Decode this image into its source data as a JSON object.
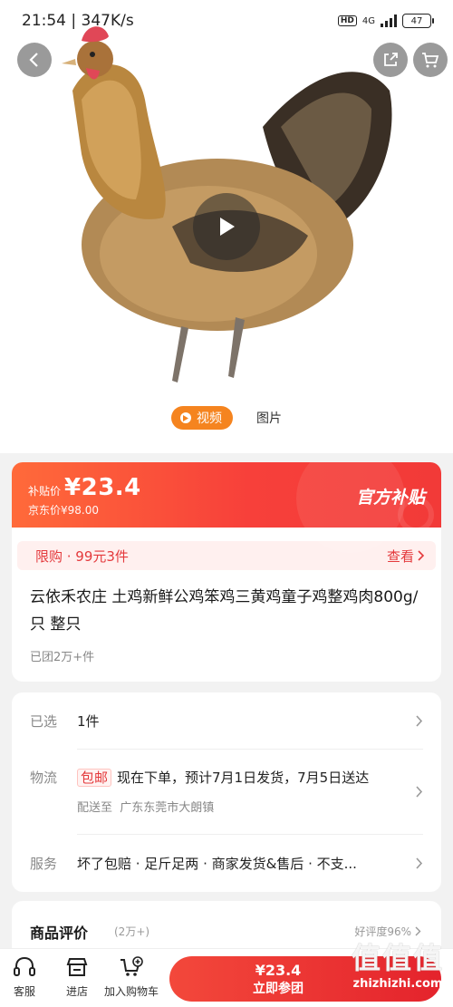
{
  "status_bar": {
    "time": "21:54 | 347K/s",
    "hd": "HD",
    "network": "4G",
    "battery": "47"
  },
  "media": {
    "video_tab": "视频",
    "photo_tab": "图片"
  },
  "price": {
    "subsidy_label": "补贴价",
    "subsidy_price": "¥23.4",
    "jd_price": "京东价¥98.00",
    "official_badge": "官方补贴"
  },
  "promo": {
    "text": "限购 · 99元3件",
    "link": "查看"
  },
  "product": {
    "title": "云依禾农庄 土鸡新鲜公鸡笨鸡三黄鸡童子鸡整鸡肉800g/只 整只",
    "sold": "已团2万+件"
  },
  "info": {
    "selected_key": "已选",
    "selected_value": "1件",
    "logistics_key": "物流",
    "free_shipping_tag": "包邮",
    "logistics_value": "现在下单，预计7月1日发货，7月5日送达",
    "ship_to": "配送至",
    "address": "广东东莞市大朗镇",
    "service_key": "服务",
    "service_value": "坏了包赔 · 足斤足两 · 商家发货&售后 · 不支..."
  },
  "reviews": {
    "title": "商品评价",
    "count": "(2万+)",
    "rating": "好评度96%"
  },
  "bottom_bar": {
    "service": "客服",
    "store": "进店",
    "add_cart": "加入购物车",
    "buy_price": "¥23.4",
    "buy_label": "立即参团"
  },
  "watermark": {
    "big": "值值值",
    "small": "zhizhizhi.com"
  },
  "colors": {
    "accent": "#e4393c",
    "orange": "#f5841f"
  }
}
